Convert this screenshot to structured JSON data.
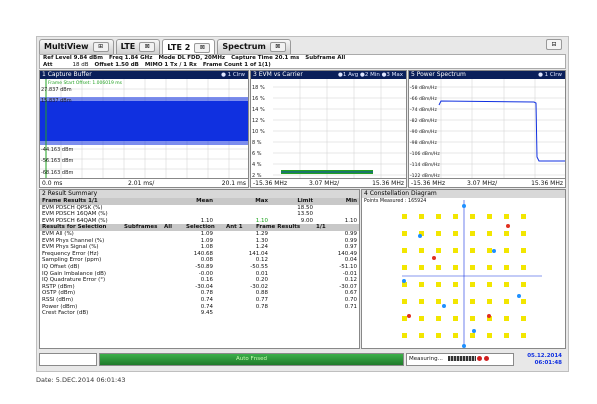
{
  "tabs": [
    {
      "label": "MultiView",
      "close": "⊞"
    },
    {
      "label": "LTE",
      "close": "⊠"
    },
    {
      "label": "LTE 2",
      "close": "⊠"
    },
    {
      "label": "Spectrum",
      "close": "⊠"
    }
  ],
  "corner_button": "⊟",
  "params": {
    "ref_level": "Ref Level 9.84 dBm",
    "freq": "Freq  1.84 GHz",
    "mode": "Mode DL FDD, 20MHz",
    "capture_time": "Capture Time  20.1 ms",
    "subframe": "Subframe All",
    "att": "Att",
    "att_val": "18 dB",
    "offset": "Offset  1.50 dB",
    "mimo": "MIMO  1 Tx / 1 Rx",
    "frame_count": "Frame Count 1 of 1(1)"
  },
  "panels": {
    "capture": {
      "title": "1 Capture Buffer",
      "legend": "● 1 Clrw",
      "marker": "Frame Start Offset: 1.006019 ms",
      "y_labels": [
        "27.837 dBm",
        "15.837 dBm",
        "-44.163 dBm",
        "-56.163 dBm",
        "-68.163 dBm"
      ],
      "x_start": "0.0 ms",
      "x_mid": "2.01 ms/",
      "x_end": "20.1 ms"
    },
    "evm": {
      "title": "3 EVM vs Carrier",
      "legend": "●1 Avg ●2 Min ●3 Max",
      "y_labels": [
        "18 %",
        "16 %",
        "14 %",
        "12 %",
        "10 %",
        "8 %",
        "6 %",
        "4 %",
        "2 %"
      ],
      "x_start": "-15.36 MHz",
      "x_mid": "3.07 MHz/",
      "x_end": "15.36 MHz"
    },
    "power": {
      "title": "5 Power Spectrum",
      "legend": "● 1 Clrw",
      "y_labels": [
        "-58 dBm/Hz",
        "-66 dBm/Hz",
        "-74 dBm/Hz",
        "-82 dBm/Hz",
        "-90 dBm/Hz",
        "-98 dBm/Hz",
        "-106 dBm/Hz",
        "-114 dBm/Hz",
        "-122 dBm/Hz"
      ],
      "x_start": "-15.36 MHz",
      "x_mid": "3.07 MHz/",
      "x_end": "15.36 MHz"
    },
    "result": {
      "title": "2 Result Summary"
    },
    "constellation": {
      "title": "4 Constellation Diagram",
      "points_measured": "Points Measured : 165924"
    }
  },
  "result_table": {
    "hdr1": [
      "Frame Results 1/1",
      "Mean",
      "Max",
      "Limit",
      "Min"
    ],
    "rows1": [
      [
        "EVM PDSCH QPSK (%)",
        "",
        "",
        "18.50",
        ""
      ],
      [
        "EVM PDSCH 16QAM (%)",
        "",
        "",
        "13.50",
        ""
      ],
      [
        "EVM PDSCH 64QAM (%)",
        "1.10",
        "1.10",
        "9.00",
        "1.10"
      ]
    ],
    "hdr2": [
      "Results for Selection",
      "Subframes",
      "All",
      "Selection",
      "Ant 1",
      "Frame Results",
      "1/1"
    ],
    "rows2": [
      [
        "EVM All (%)",
        "1.09",
        "1.29",
        "",
        "0.99"
      ],
      [
        "EVM Phys Channel (%)",
        "1.09",
        "1.30",
        "",
        "0.99"
      ],
      [
        "EVM Phys Signal (%)",
        "1.08",
        "1.24",
        "",
        "0.97"
      ],
      [
        "Frequency Error (Hz)",
        "140.68",
        "141.04",
        "",
        "140.49"
      ],
      [
        "Sampling Error (ppm)",
        "0.08",
        "0.12",
        "",
        "0.04"
      ],
      [
        "IQ Offset (dB)",
        "-50.89",
        "-50.55",
        "",
        "-51.10"
      ],
      [
        "IQ Gain Imbalance (dB)",
        "-0.00",
        "0.01",
        "",
        "-0.01"
      ],
      [
        "IQ Quadrature Error (°)",
        "0.16",
        "0.20",
        "",
        "0.12"
      ],
      [
        "RSTP (dBm)",
        "-30.04",
        "-30.02",
        "",
        "-30.07"
      ],
      [
        "OSTP (dBm)",
        "0.78",
        "0.88",
        "",
        "0.67"
      ],
      [
        "RSSI (dBm)",
        "0.74",
        "0.77",
        "",
        "0.70"
      ],
      [
        "Power (dBm)",
        "0.74",
        "0.78",
        "",
        "0.71"
      ],
      [
        "Crest Factor (dB)",
        "9.45",
        "",
        "",
        ""
      ]
    ]
  },
  "status": {
    "green_label": "Auto Fnsed",
    "measuring": "Measuring...",
    "date": "05.12.2014",
    "time": "06:01:48"
  },
  "caption": "Date: 5.DEC.2014  06:01:43",
  "colors": {
    "title_bar": "#0a1f5a",
    "trace_blue": "#1030e0",
    "trace_green": "#22a022",
    "const_yellow": "#f2e600",
    "const_blue": "#1e90ff",
    "const_red": "#e03020"
  }
}
